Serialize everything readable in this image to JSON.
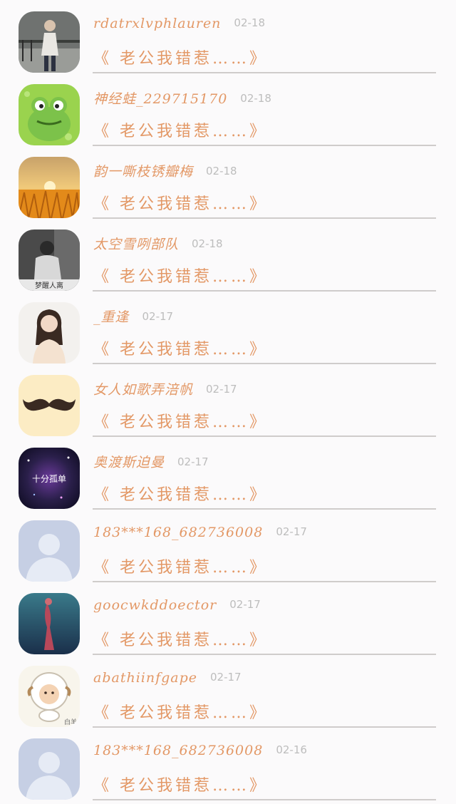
{
  "messages": [
    {
      "name": "rdatrxlvphlauren",
      "date": "02-18",
      "text": "《 老公我错惹……》",
      "avatar": "photo-person-standing"
    },
    {
      "name": "神经蛙_229715170",
      "date": "02-18",
      "text": "《 老公我错惹……》",
      "avatar": "frog-cartoon"
    },
    {
      "name": "韵一嘶枝锈瓣梅",
      "date": "02-18",
      "text": "《 老公我错惹……》",
      "avatar": "sunset-wheat-field"
    },
    {
      "name": "太空雪咧部队",
      "date": "02-18",
      "text": "《 老公我错惹……》",
      "avatar": "photo-person-dark",
      "avatar_caption": "梦醒人离"
    },
    {
      "name": "_重逢",
      "date": "02-17",
      "text": "《 老公我错惹……》",
      "avatar": "photo-girl"
    },
    {
      "name": "女人如歌弄涪帆",
      "date": "02-17",
      "text": "《 老公我错惹……》",
      "avatar": "mustache"
    },
    {
      "name": "奥渡斯迫曼",
      "date": "02-17",
      "text": "《 老公我错惹……》",
      "avatar": "galaxy-text",
      "avatar_caption": "十分孤单"
    },
    {
      "name": "183***168_682736008",
      "date": "02-17",
      "text": "《 老公我错惹……》",
      "avatar": "default-user"
    },
    {
      "name": "goocwkddoector",
      "date": "02-17",
      "text": "《 老公我错惹……》",
      "avatar": "underwater-figure"
    },
    {
      "name": "abathiinfgape",
      "date": "02-17",
      "text": "《 老公我错惹……》",
      "avatar": "sheep-cartoon",
      "avatar_caption": "白羊"
    },
    {
      "name": "183***168_682736008",
      "date": "02-16",
      "text": "《 老公我错惹……》",
      "avatar": "default-user"
    }
  ]
}
